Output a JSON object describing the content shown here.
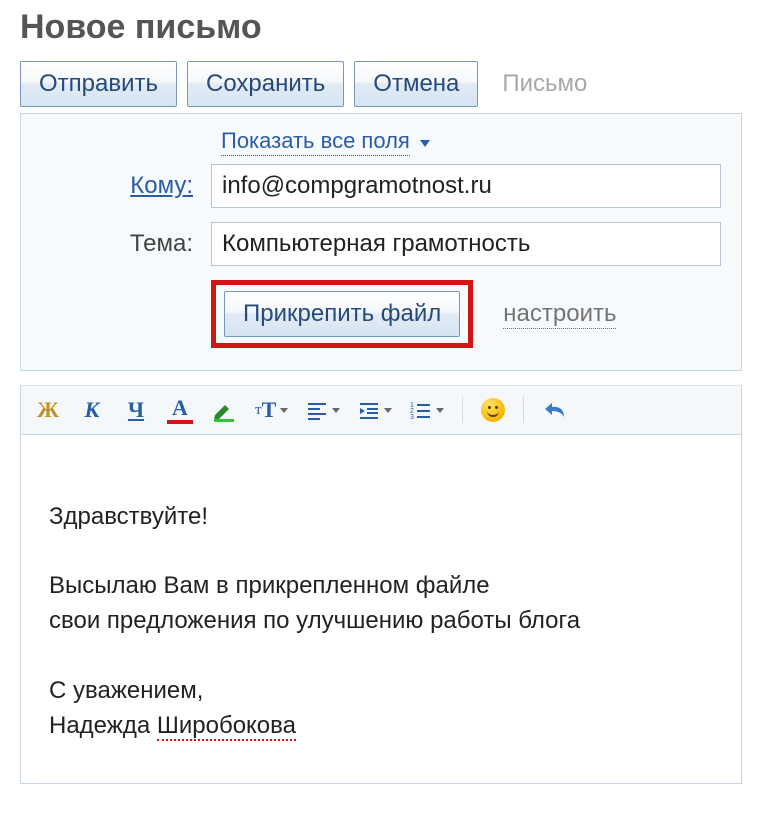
{
  "page_title": "Новое письмо",
  "toolbar": {
    "send_label": "Отправить",
    "save_label": "Сохранить",
    "cancel_label": "Отмена",
    "tab_label": "Письмо"
  },
  "compose": {
    "show_all_label": "Показать все поля",
    "to_label": "Кому:",
    "to_value": "info@compgramotnost.ru",
    "subject_label": "Тема:",
    "subject_value": "Компьютерная грамотность",
    "attach_label": "Прикрепить файл",
    "configure_label": "настроить"
  },
  "editor_icons": {
    "bold": "Ж",
    "italic": "К",
    "underline": "Ч",
    "fontcolor": "А",
    "fontsize": "тТ"
  },
  "body": {
    "greeting": "Здравствуйте!",
    "para": "Высылаю Вам в прикрепленном файле\nсвои предложения по улучшению работы блога",
    "sign1": "С уважением,",
    "sign2_first": "Надежда ",
    "sign2_last": "Широбокова"
  }
}
